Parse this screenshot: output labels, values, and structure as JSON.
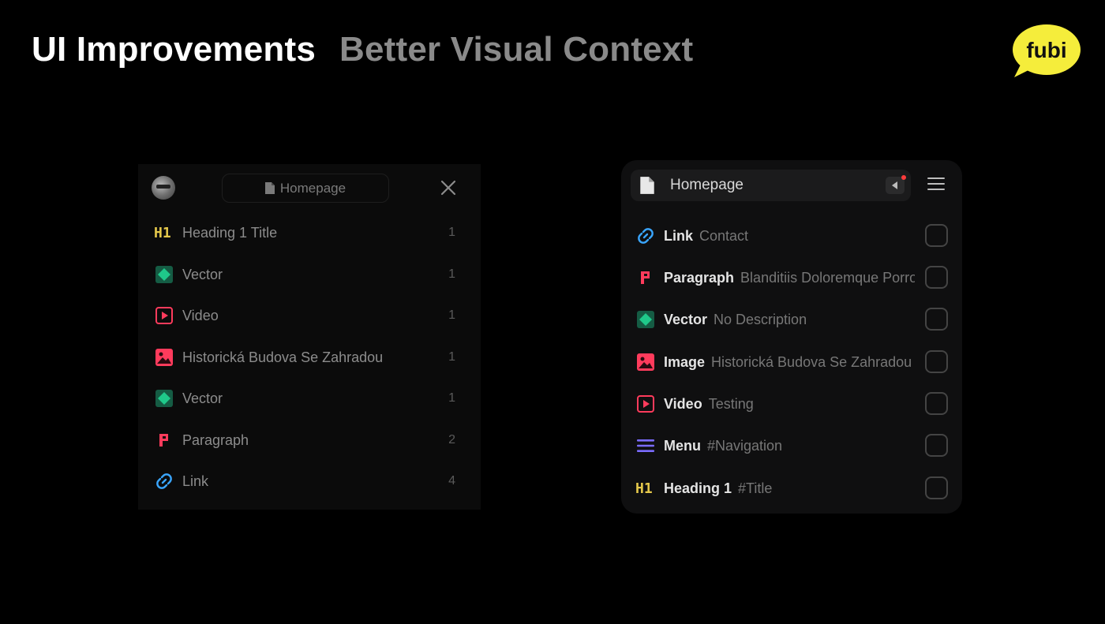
{
  "title": {
    "primary": "UI Improvements",
    "secondary": "Better Visual Context"
  },
  "logo": {
    "text": "fubi",
    "color": "#f5ed3b"
  },
  "colors": {
    "heading": "#e5c84b",
    "vector": "#1fc98a",
    "video": "#ff3b5c",
    "image": "#ff3b5c",
    "paragraph": "#ff3b5c",
    "link": "#3aa6ff",
    "menu": "#7b6cff"
  },
  "old_panel": {
    "tab_label": "Homepage",
    "items": [
      {
        "icon": "heading-1-icon",
        "label": "Heading 1 Title",
        "count": "1"
      },
      {
        "icon": "vector-icon",
        "label": "Vector",
        "count": "1"
      },
      {
        "icon": "video-icon",
        "label": "Video",
        "count": "1"
      },
      {
        "icon": "image-icon",
        "label": "Historická Budova Se Zahradou",
        "count": "1"
      },
      {
        "icon": "vector-icon",
        "label": "Vector",
        "count": "1"
      },
      {
        "icon": "paragraph-icon",
        "label": "Paragraph",
        "count": "2"
      },
      {
        "icon": "link-icon",
        "label": "Link",
        "count": "4"
      }
    ]
  },
  "new_panel": {
    "tab_label": "Homepage",
    "items": [
      {
        "icon": "link-icon",
        "name": "Link",
        "desc": "Contact"
      },
      {
        "icon": "paragraph-icon",
        "name": "Paragraph",
        "desc": "Blanditiis Doloremque Porro"
      },
      {
        "icon": "vector-icon",
        "name": "Vector",
        "desc": "No Description"
      },
      {
        "icon": "image-icon",
        "name": "Image",
        "desc": "Historická Budova Se Zahradou"
      },
      {
        "icon": "video-icon",
        "name": "Video",
        "desc": "Testing"
      },
      {
        "icon": "menu-icon",
        "name": "Menu",
        "desc": "#Navigation"
      },
      {
        "icon": "heading-1-icon",
        "name": "Heading 1",
        "desc": "#Title"
      }
    ]
  }
}
